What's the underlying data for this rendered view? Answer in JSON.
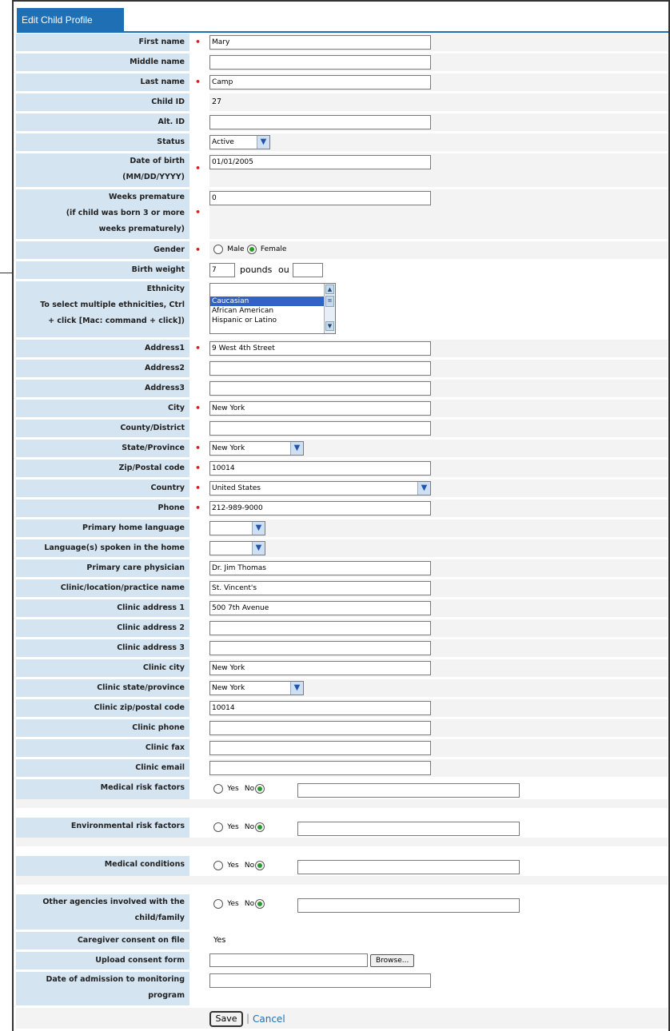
{
  "tab": {
    "title": "Edit Child Profile"
  },
  "fields": {
    "first_name": {
      "label": "First name",
      "value": "Mary"
    },
    "middle_name": {
      "label": "Middle name",
      "value": ""
    },
    "last_name": {
      "label": "Last name",
      "value": "Camp"
    },
    "child_id": {
      "label": "Child ID",
      "value": "27"
    },
    "alt_id": {
      "label": "Alt. ID",
      "value": ""
    },
    "status": {
      "label": "Status",
      "value": "Active"
    },
    "dob": {
      "label1": "Date of birth",
      "label2": "(MM/DD/YYYY)",
      "value": "01/01/2005"
    },
    "weeks_premature": {
      "label1": "Weeks premature",
      "label2": "(if child was born 3 or more",
      "label3": "weeks prematurely)",
      "value": "0"
    },
    "gender": {
      "label": "Gender",
      "male": "Male",
      "female": "Female"
    },
    "birth_weight": {
      "label": "Birth weight",
      "pounds_value": "7",
      "pounds_label": "pounds",
      "ounces_label": "ou"
    },
    "ethnicity": {
      "label1": "Ethnicity",
      "label2": "To select multiple ethnicities, Ctrl",
      "label3": "+ click [Mac: command + click])",
      "options": [
        "",
        "Caucasian",
        "African American",
        "Hispanic or Latino"
      ],
      "selected": "Caucasian"
    },
    "address1": {
      "label": "Address1",
      "value": "9 West 4th Street"
    },
    "address2": {
      "label": "Address2",
      "value": ""
    },
    "address3": {
      "label": "Address3",
      "value": ""
    },
    "city": {
      "label": "City",
      "value": "New York"
    },
    "county": {
      "label": "County/District",
      "value": ""
    },
    "state": {
      "label": "State/Province",
      "value": "New York"
    },
    "zip": {
      "label": "Zip/Postal code",
      "value": "10014"
    },
    "country": {
      "label": "Country",
      "value": "United States"
    },
    "phone": {
      "label": "Phone",
      "value": "212-989-9000"
    },
    "primary_language": {
      "label": "Primary home language",
      "value": ""
    },
    "languages_spoken": {
      "label": "Language(s) spoken in the home",
      "value": ""
    },
    "physician": {
      "label": "Primary care physician",
      "value": "Dr. Jim Thomas"
    },
    "clinic_name": {
      "label": "Clinic/location/practice name",
      "value": "St. Vincent's"
    },
    "clinic_address1": {
      "label": "Clinic address 1",
      "value": "500 7th Avenue"
    },
    "clinic_address2": {
      "label": "Clinic address 2",
      "value": ""
    },
    "clinic_address3": {
      "label": "Clinic address 3",
      "value": ""
    },
    "clinic_city": {
      "label": "Clinic city",
      "value": "New York"
    },
    "clinic_state": {
      "label": "Clinic state/province",
      "value": "New York"
    },
    "clinic_zip": {
      "label": "Clinic zip/postal code",
      "value": "10014"
    },
    "clinic_phone": {
      "label": "Clinic phone",
      "value": ""
    },
    "clinic_fax": {
      "label": "Clinic fax",
      "value": ""
    },
    "clinic_email": {
      "label": "Clinic email",
      "value": ""
    },
    "medical_risk": {
      "label": "Medical risk factors",
      "yes": "Yes",
      "no": "No",
      "value": ""
    },
    "environmental_risk": {
      "label": "Environmental risk factors",
      "yes": "Yes",
      "no": "No",
      "value": ""
    },
    "medical_conditions": {
      "label": "Medical conditions",
      "yes": "Yes",
      "no": "No",
      "value": ""
    },
    "other_agencies": {
      "label1": "Other agencies involved with the",
      "label2": "child/family",
      "yes": "Yes",
      "no": "No",
      "value": ""
    },
    "consent_on_file": {
      "label": "Caregiver consent on file",
      "value": "Yes"
    },
    "upload_consent": {
      "label": "Upload consent form",
      "value": "",
      "browse_label": "Browse..."
    },
    "admission_date": {
      "label1": "Date of admission to monitoring",
      "label2": "program",
      "value": ""
    }
  },
  "actions": {
    "save_label": "Save",
    "separator": "|",
    "cancel_label": "Cancel"
  },
  "colors": {
    "label_bg": "#d4e4f1",
    "tab_bg": "#1f6fb5",
    "required_star": "#d42020",
    "link": "#1f6fb5"
  }
}
